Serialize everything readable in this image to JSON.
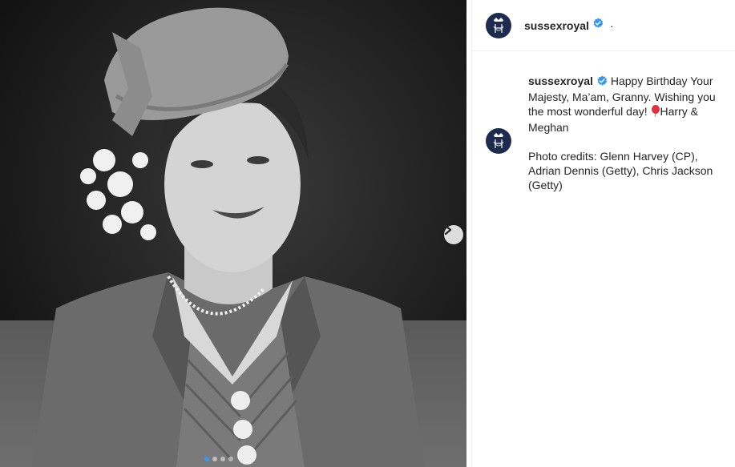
{
  "post": {
    "username": "sussexroyal",
    "more_glyph": "·",
    "avatar_icon": "monogram-crest-icon",
    "carousel": {
      "total": 4,
      "active": 1
    }
  },
  "caption": {
    "username": "sussexroyal",
    "text_before_emoji": "Happy Birthday Your Majesty, Ma’am, Granny. Wishing you the most wonderful day! ",
    "emoji_icon": "balloon-icon",
    "text_after_emoji": "Harry & Meghan",
    "credits": "Photo credits: Glenn Harvey (CP), Adrian Dennis (Getty), Chris Jackson (Getty)"
  },
  "colors": {
    "verified_blue": "#3897f0",
    "avatar_navy": "#1d2b4f",
    "balloon_red": "#e0323c",
    "divider": "#efefef"
  }
}
